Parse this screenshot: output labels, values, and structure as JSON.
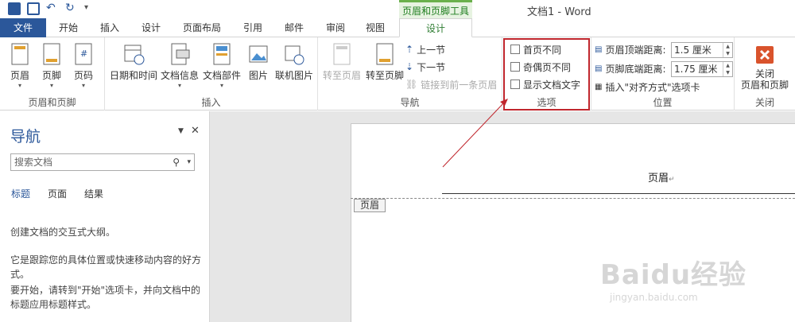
{
  "window": {
    "title": "文档1 - Word",
    "context_tab_group": "页眉和页脚工具"
  },
  "tabs": [
    "文件",
    "开始",
    "插入",
    "设计",
    "页面布局",
    "引用",
    "邮件",
    "审阅",
    "视图",
    "设计"
  ],
  "ribbon": {
    "groups": {
      "header_footer": {
        "label": "页眉和页脚",
        "buttons": [
          "页眉",
          "页脚",
          "页码"
        ]
      },
      "insert": {
        "label": "插入",
        "buttons": [
          "日期和时间",
          "文档信息",
          "文档部件",
          "图片",
          "联机图片"
        ]
      },
      "navigation": {
        "label": "导航",
        "big": [
          "转至页眉",
          "转至页脚"
        ],
        "small": [
          "上一节",
          "下一节",
          "链接到前一条页眉"
        ]
      },
      "options": {
        "label": "选项",
        "checks": [
          "首页不同",
          "奇偶页不同",
          "显示文档文字"
        ]
      },
      "position": {
        "label": "位置",
        "header_dist_label": "页眉顶端距离:",
        "header_dist_value": "1.5 厘米",
        "footer_dist_label": "页脚底端距离:",
        "footer_dist_value": "1.75 厘米",
        "insert_align_tab": "插入\"对齐方式\"选项卡"
      },
      "close": {
        "label": "关闭",
        "button": "关闭\n页眉和页脚"
      }
    }
  },
  "nav_pane": {
    "title": "导航",
    "search_placeholder": "搜索文档",
    "tabs": [
      "标题",
      "页面",
      "结果"
    ],
    "text1": "创建文档的交互式大纲。",
    "text2": "它是跟踪您的具体位置或快速移动内容的好方式。",
    "text3": "要开始，请转到\"开始\"选项卡，并向文档中的标题应用标题样式。"
  },
  "document": {
    "header_text": "页眉",
    "header_tag": "页眉",
    "para_mark": "↵"
  },
  "watermark": {
    "brand": "Baidu经验",
    "url": "jingyan.baidu.com"
  },
  "colors": {
    "file_tab": "#2b579a",
    "context_green": "#1e7d1e",
    "highlight_red": "#c0262d"
  }
}
